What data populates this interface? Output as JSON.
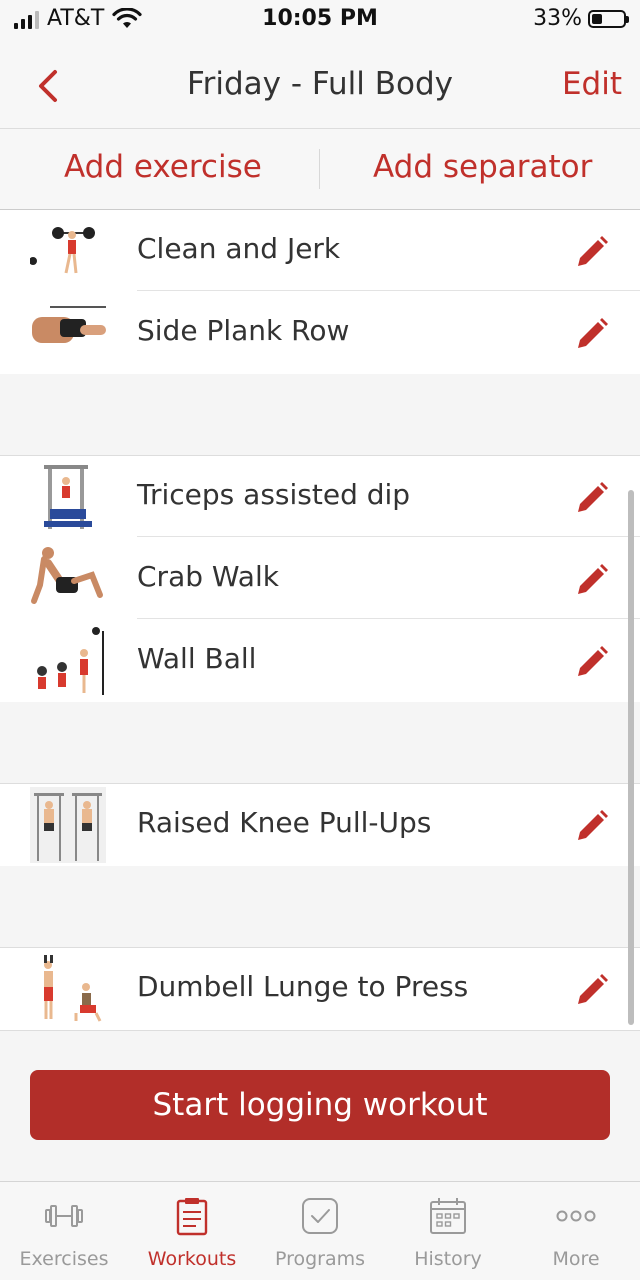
{
  "status_bar": {
    "carrier": "AT&T",
    "time": "10:05 PM",
    "battery": "33%"
  },
  "nav": {
    "title": "Friday - Full Body",
    "edit_label": "Edit",
    "back_icon": "chevron-left-icon"
  },
  "actions": {
    "add_exercise": "Add exercise",
    "add_separator": "Add separator"
  },
  "exercises": [
    {
      "name": "Clean and Jerk"
    },
    {
      "name": "Side Plank Row"
    },
    {
      "name": "Triceps assisted dip"
    },
    {
      "name": "Crab Walk"
    },
    {
      "name": "Wall Ball"
    },
    {
      "name": "Raised Knee Pull-Ups"
    },
    {
      "name": "Dumbell Lunge to Press"
    }
  ],
  "start_button": "Start logging workout",
  "tabs": [
    {
      "label": "Exercises",
      "icon": "dumbbell-icon"
    },
    {
      "label": "Workouts",
      "icon": "clipboard-icon"
    },
    {
      "label": "Programs",
      "icon": "checkbox-icon"
    },
    {
      "label": "History",
      "icon": "calendar-icon"
    },
    {
      "label": "More",
      "icon": "more-dots-icon"
    }
  ],
  "colors": {
    "accent": "#c0302b",
    "button": "#b22e29",
    "inactive": "#9a9a9a"
  }
}
